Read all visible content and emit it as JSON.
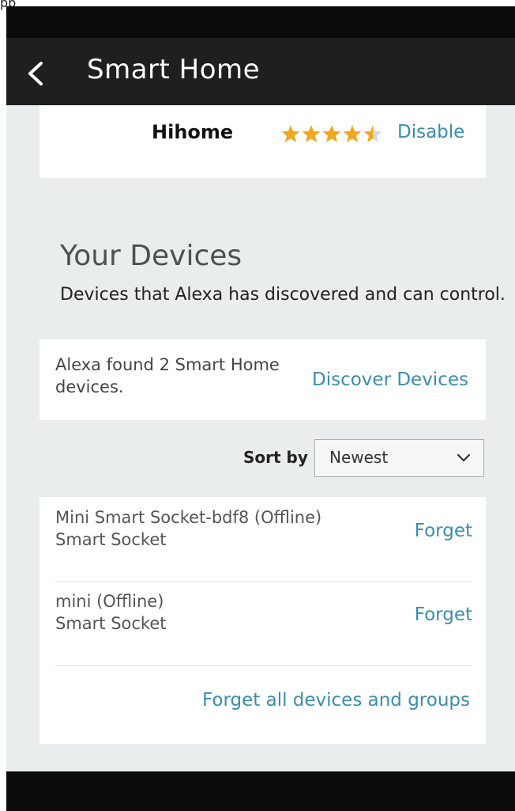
{
  "top_strip_text": "pp",
  "header": {
    "title": "Smart Home"
  },
  "skill": {
    "name": "Hihome",
    "rating": 4.5,
    "disable_label": "Disable"
  },
  "your_devices": {
    "heading": "Your Devices",
    "subtitle": "Devices that Alexa has discovered and can control."
  },
  "discover": {
    "found_text": "Alexa found 2 Smart Home devices.",
    "button_label": "Discover Devices"
  },
  "sort": {
    "label": "Sort by",
    "selected": "Newest"
  },
  "devices": [
    {
      "name": "Mini Smart Socket-bdf8 (Offline)",
      "type": "Smart Socket",
      "action": "Forget"
    },
    {
      "name": "mini (Offline)",
      "type": "Smart Socket",
      "action": "Forget"
    }
  ],
  "forget_all_label": "Forget all devices and groups",
  "colors": {
    "link": "#3a8dae",
    "star": "#f0a81e",
    "header_bg": "#1f1f1f",
    "page_bg": "#eaeded"
  }
}
